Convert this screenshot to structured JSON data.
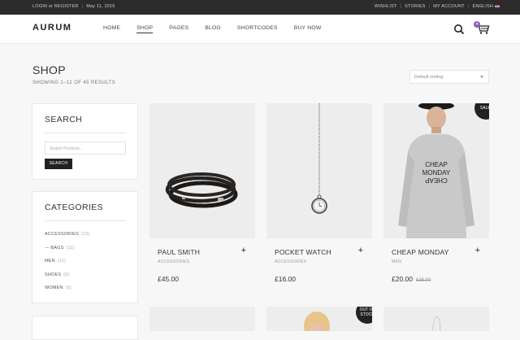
{
  "topbar": {
    "login": "LOGIN or REGISTER",
    "date": "May 11, 2015",
    "links": [
      "WISHLIST",
      "STORIES",
      "MY ACCOUNT",
      "ENGLISH"
    ]
  },
  "header": {
    "logo": "AURUM",
    "nav": [
      "HOME",
      "SHOP",
      "PAGES",
      "BLOG",
      "SHORTCODES",
      "BUY NOW"
    ],
    "cart_count": "4"
  },
  "page": {
    "title": "SHOP",
    "results": "SHOWING 1–12 OF 45 RESULTS",
    "sort": "Default sorting"
  },
  "sidebar": {
    "search": {
      "title": "SEARCH",
      "placeholder": "Search Products...",
      "button": "SEARCH"
    },
    "categories": {
      "title": "CATEGORIES",
      "items": [
        {
          "label": "ACCESSORIES",
          "count": "(23)"
        },
        {
          "label": "— BAGS",
          "count": "(11)"
        },
        {
          "label": "MEN",
          "count": "(11)"
        },
        {
          "label": "SHOES",
          "count": "(6)"
        },
        {
          "label": "WOMEN",
          "count": "(5)"
        }
      ]
    }
  },
  "products": [
    {
      "name": "PAUL SMITH",
      "category": "ACCESSORIES",
      "price": "£45.00",
      "old_price": ""
    },
    {
      "name": "POCKET WATCH",
      "category": "ACCESSORIES",
      "price": "£16.00",
      "old_price": ""
    },
    {
      "name": "CHEAP MONDAY",
      "category": "MEN",
      "price": "£20.00",
      "old_price": "£35.00",
      "badge": "SALE!"
    }
  ],
  "row2_badge": "OUT OF STOCK",
  "sweater_print": {
    "line1": "CHEAP",
    "line2": "MONDAY",
    "line3": "CHEAP"
  }
}
